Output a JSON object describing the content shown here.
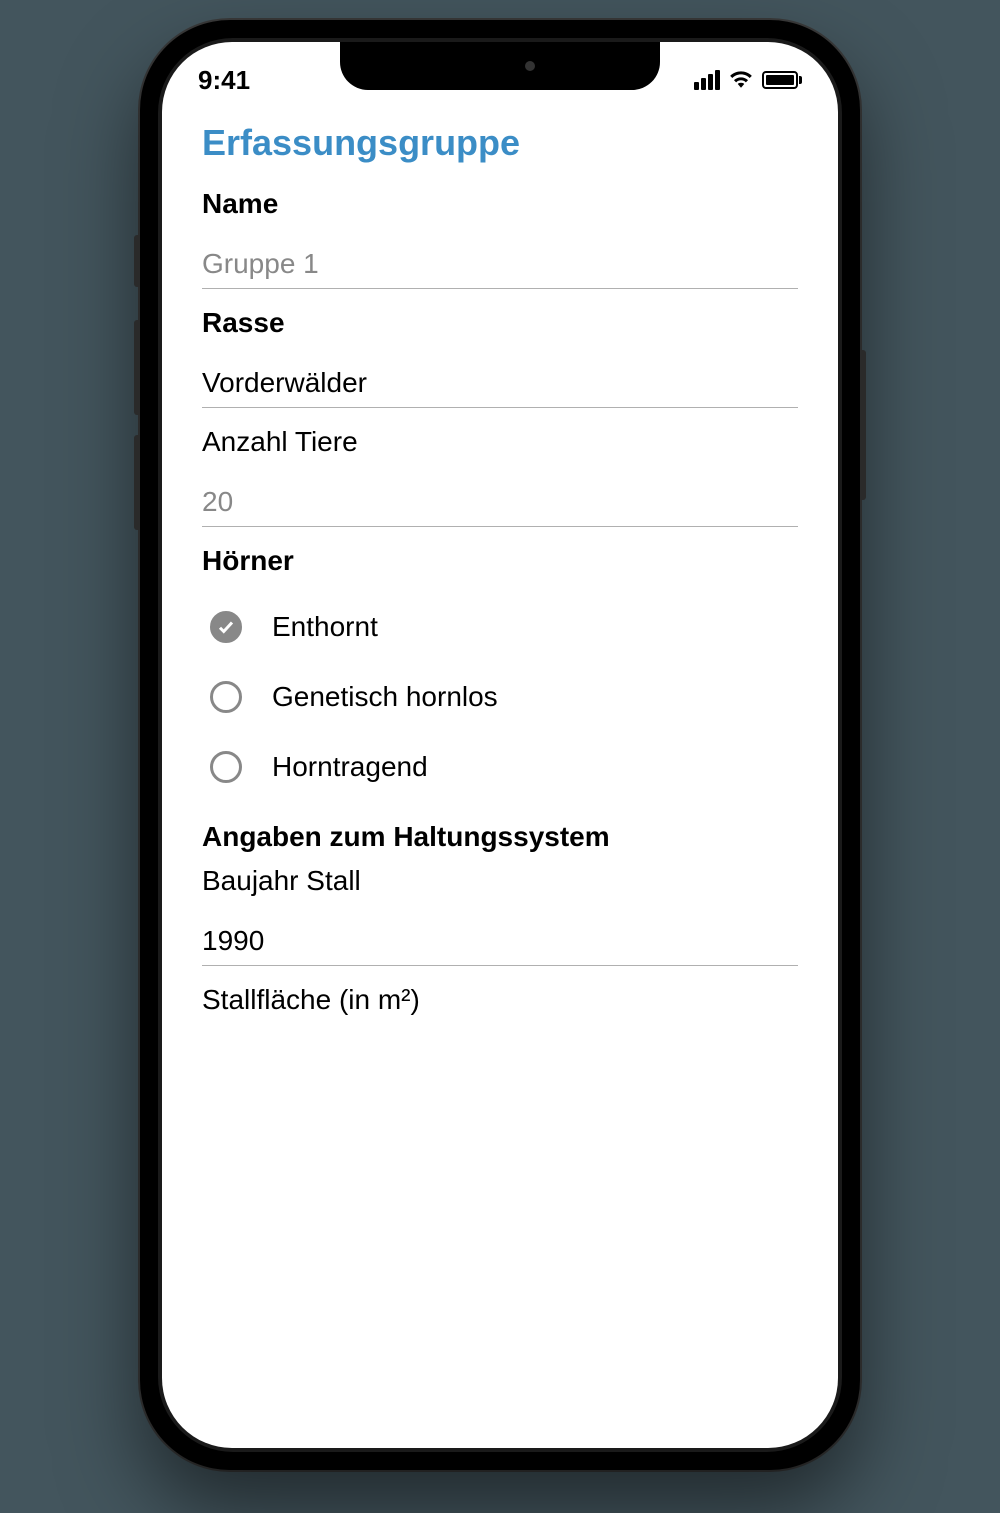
{
  "statusbar": {
    "time": "9:41"
  },
  "header": {
    "title": "Erfassungsgruppe"
  },
  "form": {
    "name": {
      "label": "Name",
      "placeholder": "Gruppe 1"
    },
    "breed": {
      "label": "Rasse",
      "value": "Vorderwälder"
    },
    "count": {
      "label": "Anzahl Tiere",
      "value": "20"
    },
    "horns": {
      "label": "Hörner",
      "options": {
        "dehorned": "Enthornt",
        "genetic": "Genetisch hornlos",
        "horned": "Horntragend"
      }
    },
    "housing": {
      "heading": "Angaben zum Haltungssystem",
      "year": {
        "label": "Baujahr Stall",
        "value": "1990"
      },
      "area": {
        "label": "Stallfläche (in m²)"
      }
    }
  }
}
